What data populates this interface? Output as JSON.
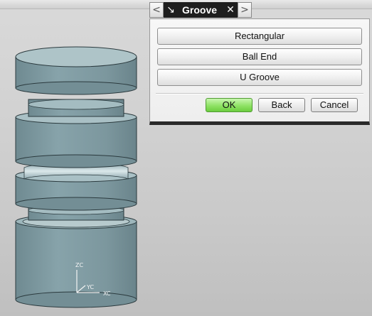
{
  "dialog": {
    "title": "Groove",
    "nav_prev_glyph": "<",
    "nav_next_glyph": ">",
    "pin_glyph": "↘",
    "close_glyph": "✕",
    "options": [
      "Rectangular",
      "Ball End",
      "U Groove"
    ],
    "ok_label": "OK",
    "back_label": "Back",
    "cancel_label": "Cancel"
  },
  "triad": {
    "z_label": "ZC",
    "y_label": "YC",
    "x_label": "XC"
  },
  "colors": {
    "model_body": "#7e9aa1",
    "model_top": "#a9c0c5",
    "ok_button": "#8fe265",
    "title_bar": "#1e1e1e"
  },
  "icons": [
    "back-arrow-icon",
    "pin-arrow-icon",
    "close-x-icon",
    "forward-arrow-icon"
  ]
}
